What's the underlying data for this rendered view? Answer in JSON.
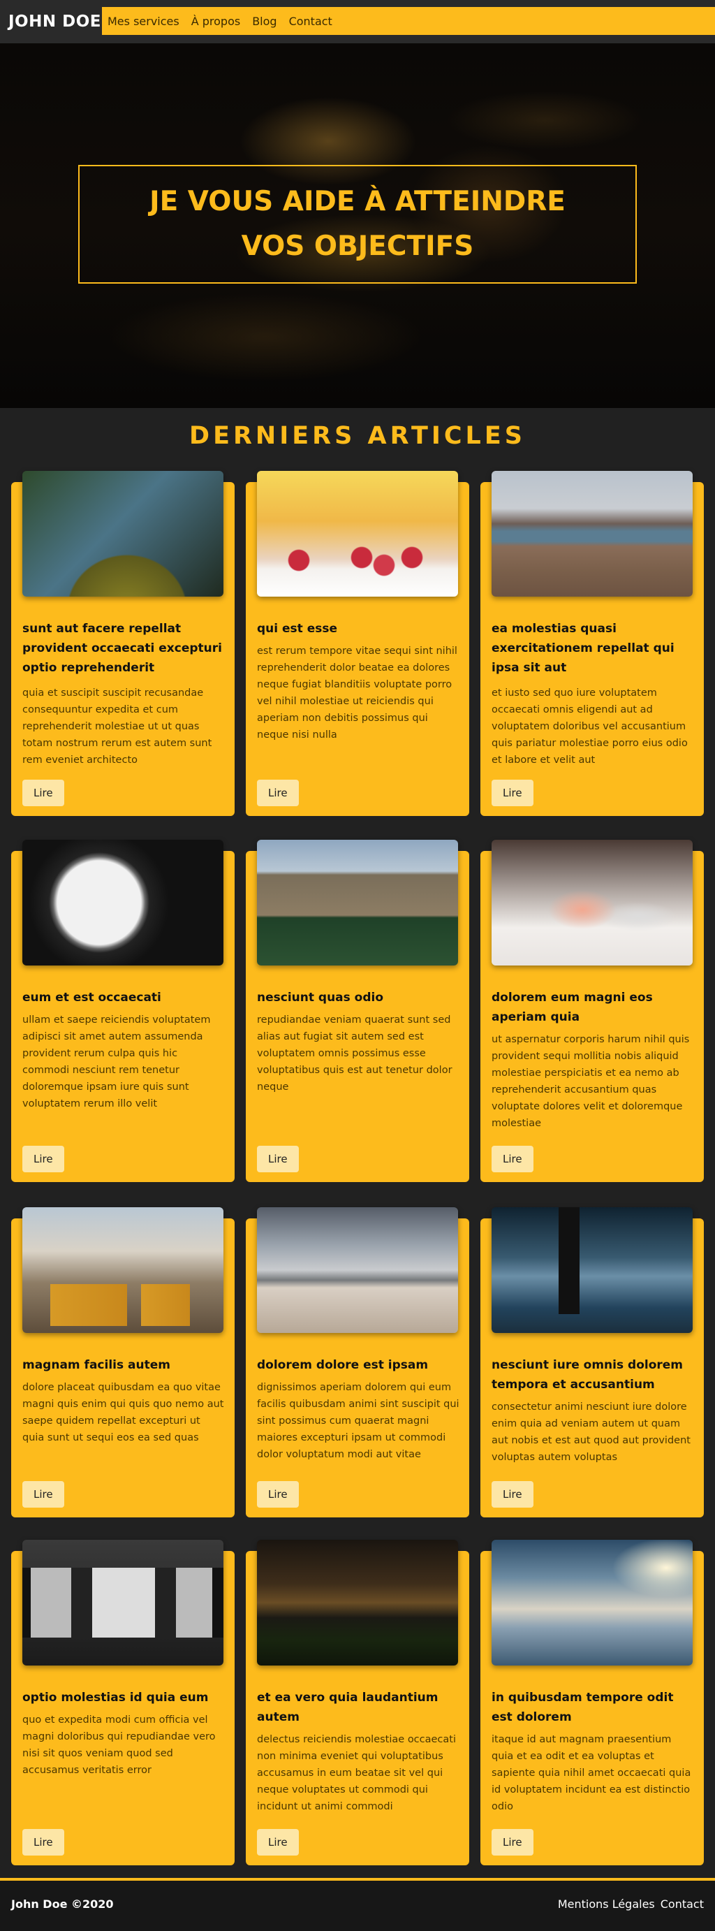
{
  "header": {
    "brand": "JOHN DOE",
    "nav": [
      "Mes services",
      "À propos",
      "Blog",
      "Contact"
    ]
  },
  "hero": {
    "title": "JE VOUS AIDE À ATTEINDRE VOS OBJECTIFS"
  },
  "articles": {
    "section_title": "DERNIERS ARTICLES",
    "button_label": "Lire",
    "items": [
      {
        "title": "sunt aut facere repellat provident occaecati excepturi optio reprehenderit",
        "body": "quia et suscipit suscipit recusandae consequuntur expedita et cum reprehenderit molestiae ut ut quas totam nostrum rerum est autem sunt rem eveniet architecto",
        "image": "moss-forest"
      },
      {
        "title": "qui est esse",
        "body": "est rerum tempore vitae sequi sint nihil reprehenderit dolor beatae ea dolores neque fugiat blanditiis voluptate porro vel nihil molestiae ut reiciendis qui aperiam non debitis possimus qui neque nisi nulla",
        "image": "raspberries"
      },
      {
        "title": "ea molestias quasi exercitationem repellat qui ipsa sit aut",
        "body": "et iusto sed quo iure voluptatem occaecati omnis eligendi aut ad voluptatem doloribus vel accusantium quis pariatur molestiae porro eius odio et labore et velit aut",
        "image": "lake-field"
      },
      {
        "title": "eum et est occaecati",
        "body": "ullam et saepe reiciendis voluptatem adipisci sit amet autem assumenda provident rerum culpa quis hic commodi nesciunt rem tenetur doloremque ipsam iure quis sunt voluptatem rerum illo velit",
        "image": "clock"
      },
      {
        "title": "nesciunt quas odio",
        "body": "repudiandae veniam quaerat sunt sed alias aut fugiat sit autem sed est voluptatem omnis possimus esse voluptatibus quis est aut tenetur dolor neque",
        "image": "college"
      },
      {
        "title": "dolorem eum magni eos aperiam quia",
        "body": "ut aspernatur corporis harum nihil quis provident sequi mollitia nobis aliquid molestiae perspiciatis et ea nemo ab reprehenderit accusantium quas voluptate dolores velit et doloremque molestiae",
        "image": "tea-cup"
      },
      {
        "title": "magnam facilis autem",
        "body": "dolore placeat quibusdam ea quo vitae magni quis enim qui quis quo nemo aut saepe quidem repellat excepturi ut quia sunt ut sequi eos ea sed quas",
        "image": "tram"
      },
      {
        "title": "dolorem dolore est ipsam",
        "body": "dignissimos aperiam dolorem qui eum facilis quibusdam animi sint suscipit qui sint possimus cum quaerat magni maiores excepturi ipsam ut commodi dolor voluptatum modi aut vitae",
        "image": "beach"
      },
      {
        "title": "nesciunt iure omnis dolorem tempora et accusantium",
        "body": "consectetur animi nesciunt iure dolore enim quia ad veniam autem ut quam aut nobis et est aut quod aut provident voluptas autem voluptas",
        "image": "person-pier"
      },
      {
        "title": "optio molestias id quia eum",
        "body": "quo et expedita modi cum officia vel magni doloribus qui repudiandae vero nisi sit quos veniam quod sed accusamus veritatis error",
        "image": "train-windows"
      },
      {
        "title": "et ea vero quia laudantium autem",
        "body": "delectus reiciendis molestiae occaecati non minima eveniet qui voluptatibus accusamus in eum beatae sit vel qui neque voluptates ut commodi qui incidunt ut animi commodi",
        "image": "barn-night"
      },
      {
        "title": "in quibusdam tempore odit est dolorem",
        "body": "itaque id aut magnam praesentium quia et ea odit et ea voluptas et sapiente quia nihil amet occaecati quia id voluptatem incidunt ea est distinctio odio",
        "image": "clouds"
      }
    ]
  },
  "footer": {
    "copyright": "John Doe ©2020",
    "links": [
      "Mentions Légales",
      "Contact"
    ]
  },
  "colors": {
    "accent": "#fdbb1c",
    "background": "#212121",
    "button": "#fde6a6"
  }
}
